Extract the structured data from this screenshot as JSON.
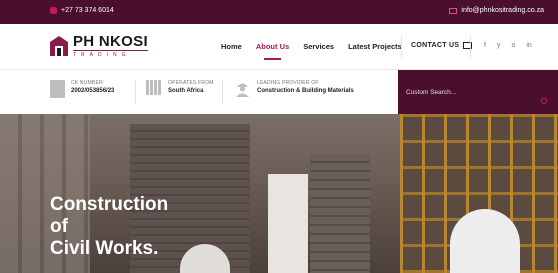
{
  "topbar": {
    "phone": "+27 73 374 6014",
    "email": "info@phnkositrading.co.za"
  },
  "brand": {
    "name": "PH NKOSI",
    "sub": "TRADING"
  },
  "nav": {
    "items": [
      {
        "label": "Home",
        "active": false
      },
      {
        "label": "About Us",
        "active": true
      },
      {
        "label": "Services",
        "active": false
      },
      {
        "label": "Latest Projects",
        "active": false
      }
    ],
    "contact_label": "CONTACT US",
    "social": [
      "f",
      "y",
      "o",
      "in"
    ]
  },
  "info": {
    "ck_label": "CK NUMBER:",
    "ck_value": "2002/053856/23",
    "operates_label": "OPERATES FROM",
    "operates_value": "South Africa",
    "leading_label": "LEADING PROVIDER OF",
    "leading_value": "Construction & Building Materials"
  },
  "search": {
    "placeholder": "Custom Search..."
  },
  "hero": {
    "line1": "Construction",
    "line2": "of",
    "line3": "Civil Works."
  },
  "colors": {
    "brand_dark": "#4a0f2c",
    "accent": "#a8185a"
  }
}
